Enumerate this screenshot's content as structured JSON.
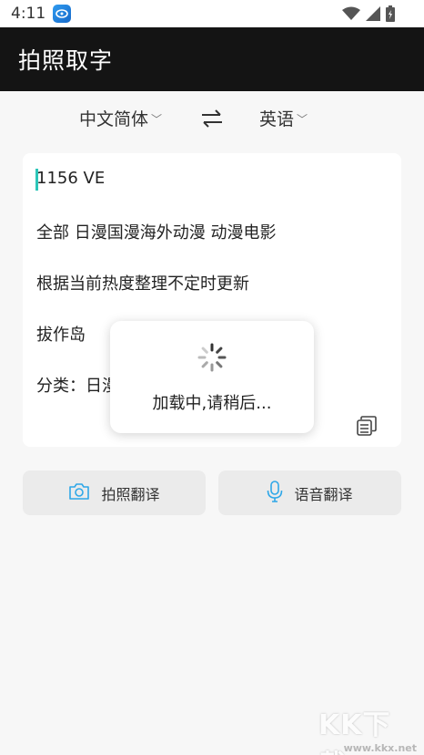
{
  "status_bar": {
    "time": "4:11"
  },
  "app_bar": {
    "title": "拍照取字"
  },
  "languages": {
    "source": "中文简体",
    "target": "英语"
  },
  "recognized_text": {
    "lines": [
      "1156 VE",
      "全部 日漫国漫海外动漫 动漫电影",
      "根据当前热度整理不定时更新",
      "拔作岛",
      "分类：日漫"
    ]
  },
  "loading": {
    "message": "加载中,请稍后..."
  },
  "actions": {
    "photo_translate": "拍照翻译",
    "voice_translate": "语音翻译"
  },
  "colors": {
    "accent": "#2ea7e8",
    "caret": "#2cc5b8",
    "app_bar": "#141414"
  },
  "watermark": {
    "logo": "KK下载",
    "url": "www.kkx.net"
  }
}
